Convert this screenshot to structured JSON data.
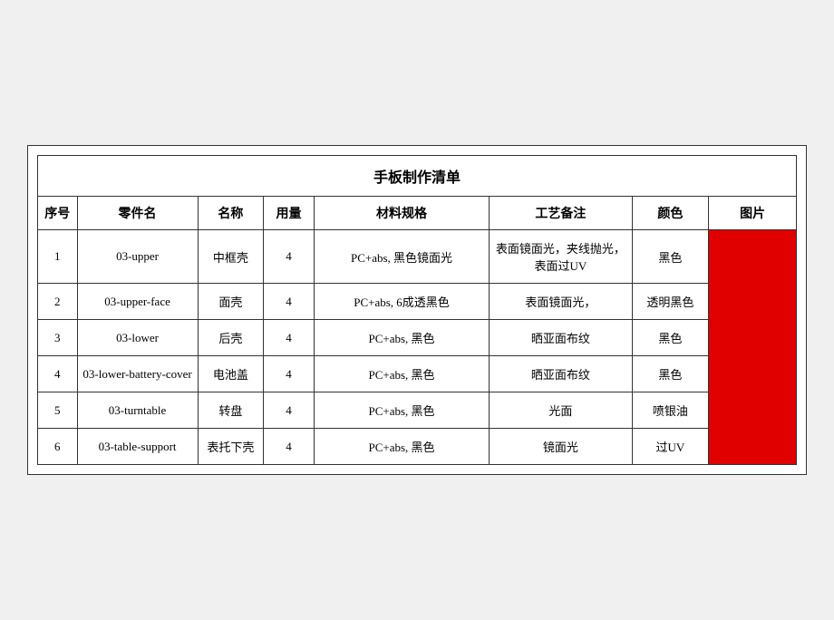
{
  "title": "手板制作清单",
  "headers": {
    "seq": "序号",
    "part_code": "零件名",
    "name": "名称",
    "qty": "用量",
    "spec": "材料规格",
    "process": "工艺备注",
    "color": "颜色",
    "image": "图片"
  },
  "rows": [
    {
      "seq": "1",
      "part_code": "03-upper",
      "name": "中框壳",
      "qty": "4",
      "spec": "PC+abs, 黑色镜面光",
      "process": "表面镜面光，夹线抛光，表面过UV",
      "color": "黑色"
    },
    {
      "seq": "2",
      "part_code": "03-upper-face",
      "name": "面壳",
      "qty": "4",
      "spec": "PC+abs, 6成透黑色",
      "process": "表面镜面光，",
      "color": "透明黑色"
    },
    {
      "seq": "3",
      "part_code": "03-lower",
      "name": "后壳",
      "qty": "4",
      "spec": "PC+abs, 黑色",
      "process": "晒亚面布纹",
      "color": "黑色"
    },
    {
      "seq": "4",
      "part_code": "03-lower-battery-cover",
      "name": "电池盖",
      "qty": "4",
      "spec": "PC+abs, 黑色",
      "process": "晒亚面布纹",
      "color": "黑色"
    },
    {
      "seq": "5",
      "part_code": "03-turntable",
      "name": "转盘",
      "qty": "4",
      "spec": "PC+abs, 黑色",
      "process": "光面",
      "color": "喷银油"
    },
    {
      "seq": "6",
      "part_code": "03-table-support",
      "name": "表托下壳",
      "qty": "4",
      "spec": "PC+abs, 黑色",
      "process": "镜面光",
      "color": "过UV"
    }
  ]
}
